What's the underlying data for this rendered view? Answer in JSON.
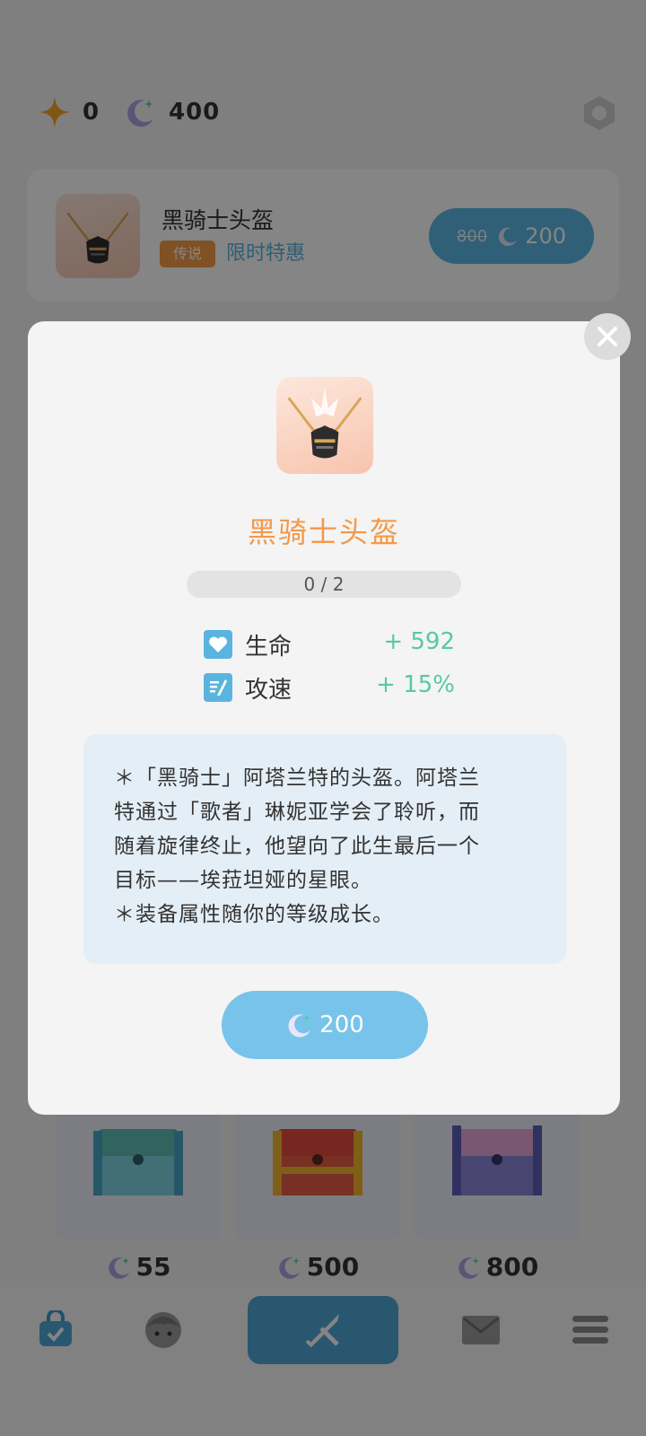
{
  "currency": {
    "star_icon": "star-icon",
    "star_value": "0",
    "moon_icon": "moon-icon",
    "moon_value": "400"
  },
  "offer": {
    "name": "黑骑士头盔",
    "rarity_tag": "传说",
    "limited_tag": "限时特惠",
    "old_price": "800",
    "new_price": "200"
  },
  "chests": [
    {
      "price": "55",
      "color": "#5fbfb7"
    },
    {
      "price": "500",
      "color": "#e34b3c"
    },
    {
      "price": "800",
      "color": "#8a86d8"
    }
  ],
  "modal": {
    "item_name": "黑骑士头盔",
    "progress": "0 / 2",
    "stats": [
      {
        "icon": "heart-icon",
        "label": "生命",
        "value": "+ 592"
      },
      {
        "icon": "attack-speed-icon",
        "label": "攻速",
        "value": "+ 15%"
      }
    ],
    "description": [
      "＊「黑骑士」阿塔兰特的头盔。阿塔兰",
      "特通过「歌者」琳妮亚学会了聆听，而",
      "随着旋律终止，他望向了此生最后一个",
      "目标——埃菈坦娅的星眼。",
      "＊装备属性随你的等级成长。"
    ],
    "buy_price": "200"
  },
  "nav": [
    "bag-icon",
    "character-icon",
    "battle-icon",
    "mail-icon",
    "menu-icon"
  ],
  "colors": {
    "accent_blue": "#5ab8e6",
    "item_name_orange": "#f3994b",
    "stat_green": "#56c9a5",
    "legend_tag": "#f39c45"
  }
}
